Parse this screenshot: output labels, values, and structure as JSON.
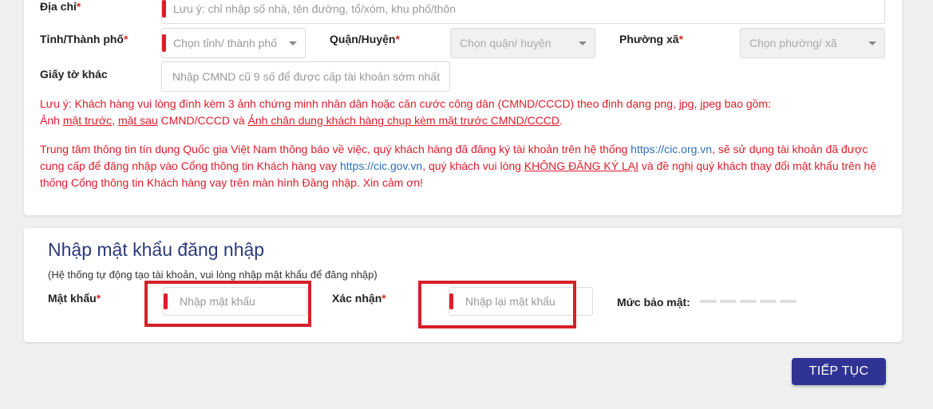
{
  "address": {
    "label": "Địa chỉ",
    "required_mark": "*",
    "placeholder": "Lưu ý: chỉ nhập số nhà, tên đường, tổ/xóm, khu phố/thôn"
  },
  "province": {
    "label": "Tỉnh/Thành phố",
    "required_mark": "*",
    "placeholder": "Chọn tỉnh/ thành phố"
  },
  "district": {
    "label": "Quận/Huyện",
    "required_mark": "*",
    "placeholder": "Chọn quận/ huyện"
  },
  "ward": {
    "label": "Phường xã",
    "required_mark": "*",
    "placeholder": "Chọn phường/ xã"
  },
  "other_doc": {
    "label": "Giấy tờ khác",
    "placeholder": "Nhập CMND cũ 9 số để được cấp tài khoản sớm nhất"
  },
  "note1": {
    "line1": "Lưu ý: Khách hàng vui lòng đính kèm 3 ảnh chứng minh nhân dân hoặc căn cước công dân (CMND/CCCD) theo định dạng png, jpg, jpeg bao gồm:",
    "l2_a": "Ảnh ",
    "l2_front": "mặt trước",
    "l2_b": ", ",
    "l2_back": "mặt sau",
    "l2_c": " CMND/CCCD và ",
    "l2_portrait": "Ảnh chân dung khách hàng chụp kèm mặt trước CMND/CCCD",
    "l2_d": "."
  },
  "note2": {
    "p1": "Trung tâm thông tin tín dụng Quốc gia Việt Nam thông báo về việc, quý khách hàng đã đăng ký tài khoản trên hệ thống ",
    "link1": "https://cic.org.vn",
    "p2": ", sẽ sử dụng tài khoản đã được cung cấp để đăng nhập vào Cổng thông tin Khách hàng vay ",
    "link2": "https://cic.gov.vn",
    "p3": ", quý khách vui lòng ",
    "emph": "KHÔNG ĐĂNG KÝ LẠI",
    "p4": " và đề nghị quý khách thay đổi mật khẩu trên hệ thống Cổng thông tin Khách hàng vay trên màn hình Đăng nhập. Xin cảm ơn!"
  },
  "password_section": {
    "title": "Nhập mật khẩu đăng nhập",
    "subtitle": "(Hệ thống tự động tạo tài khoản, vui lòng nhập mật khẩu để đăng nhập)",
    "password_label": "Mật khẩu",
    "password_placeholder": "Nhập mật khẩu",
    "confirm_label": "Xác nhận",
    "confirm_placeholder": "Nhập lại mật khẩu",
    "required_mark": "*",
    "strength_label": "Mức bảo mật:",
    "strength_level": 0,
    "strength_segments": 5
  },
  "continue_button": "TIẾP TỤC",
  "colors": {
    "accent": "#2f3494",
    "required": "#e01b2a",
    "highlight": "#d6202a",
    "title": "#2c3a7a",
    "link": "#2f6fb5"
  }
}
